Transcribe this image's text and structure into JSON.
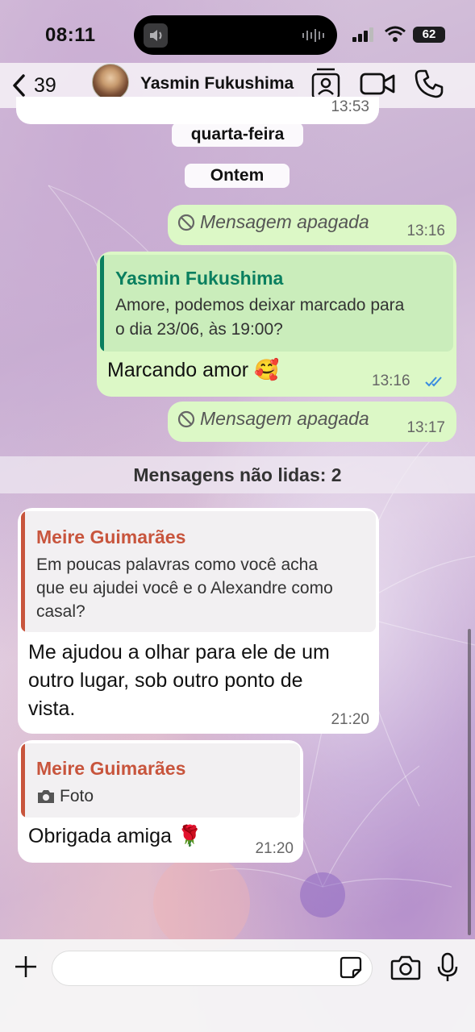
{
  "status_bar": {
    "time": "08:11",
    "battery": "62"
  },
  "header": {
    "back_count": "39",
    "contact_name": "Yasmin Fukushima"
  },
  "dates": {
    "wednesday": "quarta-feira",
    "yesterday": "Ontem"
  },
  "prev_bubble_time": "13:53",
  "messages": [
    {
      "type": "deleted",
      "text": "Mensagem apagada",
      "time": "13:16"
    },
    {
      "type": "reply_out",
      "quote_name": "Yasmin Fukushima",
      "quote_line1": "Amore, podemos deixar marcado para",
      "quote_line2": "o dia 23/06, às 19:00?",
      "text": "Marcando amor 🥰",
      "time": "13:16"
    },
    {
      "type": "deleted",
      "text": "Mensagem apagada",
      "time": "13:17"
    }
  ],
  "unread_banner": "Mensagens não lidas: 2",
  "incoming": [
    {
      "quote_name": "Meire Guimarães",
      "quote_line1": "Em poucas palavras como você acha",
      "quote_line2": "que eu ajudei você e o Alexandre como",
      "quote_line3": "casal?",
      "line1": "Me ajudou a olhar para ele de um",
      "line2": "outro lugar, sob outro ponto de",
      "line3": "vista.",
      "time": "21:20"
    },
    {
      "quote_name": "Meire Guimarães",
      "quote_text": "Foto",
      "text": "Obrigada amiga 🌹",
      "time": "21:20"
    }
  ],
  "colors": {
    "outgoing_bubble": "#dcf8c6",
    "incoming_bubble": "#ffffff",
    "reply_name_out": "#0a7f5f",
    "reply_name_in": "#c8553d",
    "read_ticks": "#3a8be0"
  }
}
